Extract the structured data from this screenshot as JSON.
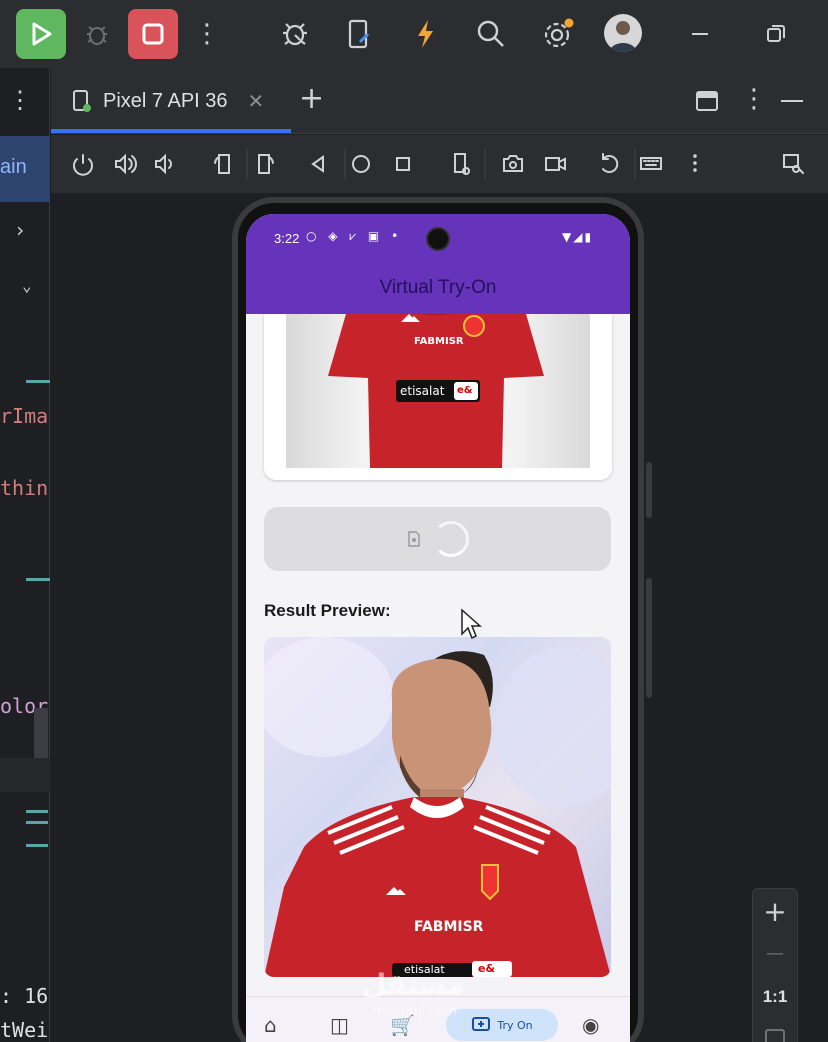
{
  "ide": {
    "toolbar": {
      "run_icon": "play-icon",
      "debug_icon": "bug-icon",
      "stop_icon": "stop-icon",
      "more_icon": "vertical-dots-icon",
      "profile_icon": "profiler-icon",
      "device_mirror_icon": "device-mirror-icon",
      "apply_changes_icon": "lightning-icon",
      "search_icon": "search-icon",
      "settings_icon": "gear-icon",
      "avatar_icon": "avatar",
      "minimize_icon": "minimize-icon",
      "restore_icon": "restore-icon"
    },
    "colors": {
      "run_green": "#5fb85f",
      "stop_red": "#d8545a",
      "tab_accent": "#3574f0",
      "app_purple": "#6633bb"
    },
    "left_panel": {
      "partial_tab": "ain",
      "code_fragments": [
        "rIma",
        "thin",
        "olor",
        ": 16",
        "tWei"
      ]
    },
    "device_tab": {
      "label": "Pixel 7 API 36",
      "close_icon": "close-icon",
      "add_icon": "plus-icon"
    },
    "device_controls": [
      "power-icon",
      "volume-up-icon",
      "volume-down-icon",
      "rotate-left-icon",
      "rotate-right-icon",
      "back-icon",
      "home-icon",
      "overview-icon",
      "device-settings-icon",
      "camera-icon",
      "record-icon",
      "reset-icon",
      "keyboard-icon",
      "more-icon",
      "inspect-icon"
    ],
    "zoom": {
      "plus": "+",
      "minus": "—",
      "ratio": "1:1"
    }
  },
  "phone": {
    "status": {
      "time": "3:22"
    },
    "app_title": "Virtual Try-On",
    "jersey": {
      "sponsor_top": "FABMISR",
      "sponsor_main": "etisalat",
      "sponsor_badge": "e&"
    },
    "result_label": "Result Preview:",
    "result_jersey": {
      "sponsor_top": "FABMISR",
      "sponsor_main": "etisalat",
      "sponsor_badge": "e&"
    },
    "bottom_nav": {
      "active_label": "Try On",
      "items": [
        "home-icon",
        "bag-icon",
        "cart-icon",
        "try-on-icon",
        "profile-icon"
      ]
    }
  },
  "watermark": {
    "text": "مستقل",
    "url": "mostaql.com"
  }
}
